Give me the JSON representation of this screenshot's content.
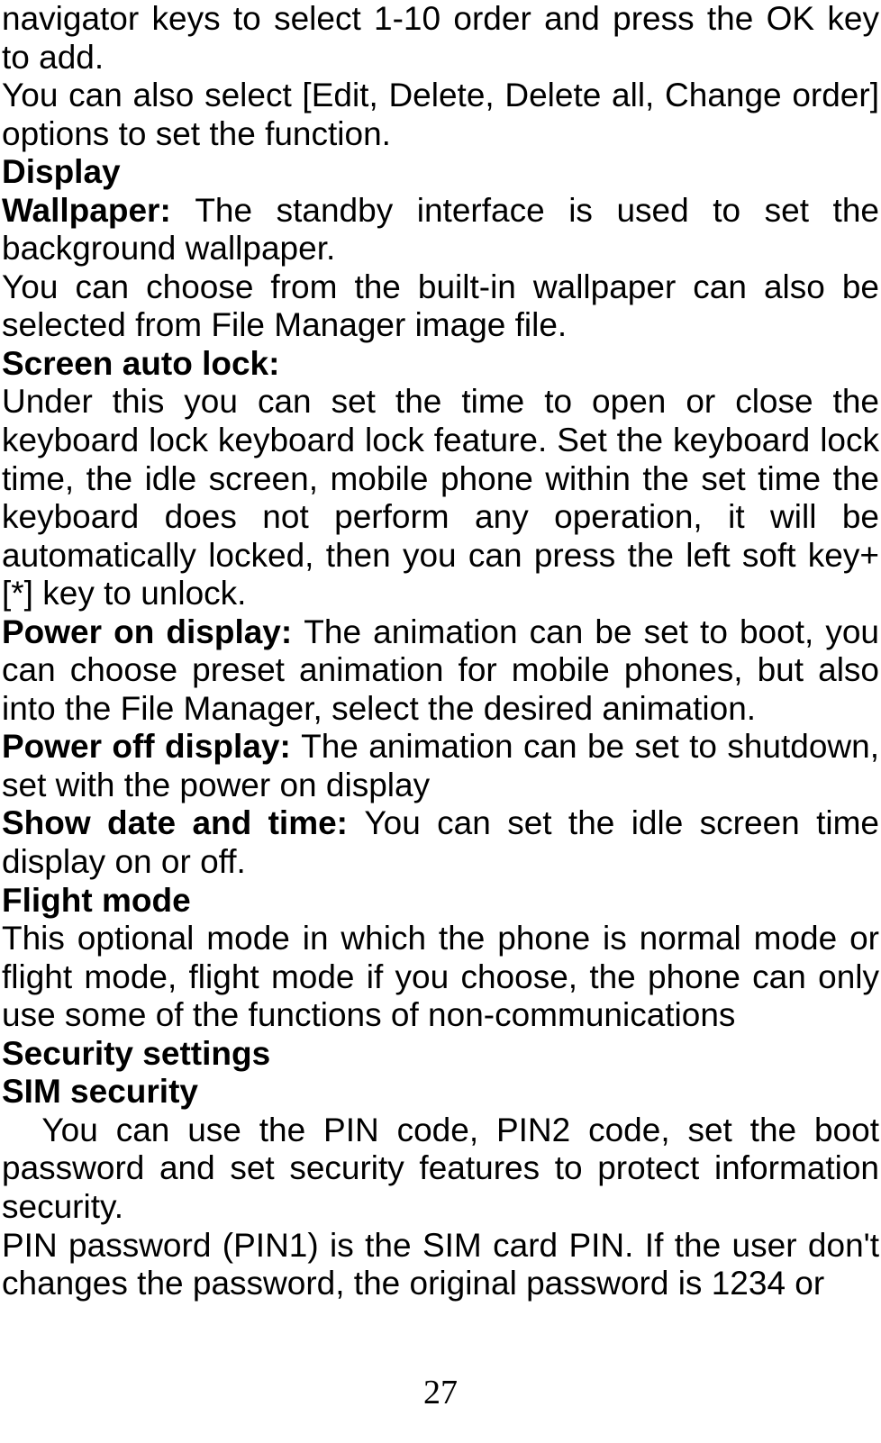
{
  "paragraphs": {
    "p1": "navigator keys to select 1-10 order and press the OK key to add.",
    "p2": "You can also select [Edit, Delete, Delete all, Change order] options to set the function.",
    "h_display": "Display",
    "wallpaper_label": "Wallpaper: ",
    "wallpaper_text": "The standby interface is used to set the background wallpaper.",
    "wallpaper_p2": "You can choose from the built-in wallpaper can also be selected from File Manager image file.",
    "screen_auto_lock_label": "Screen auto lock:",
    "screen_auto_lock_text": "Under this you can set the time to open or close the keyboard lock keyboard lock feature. Set the keyboard lock time, the idle screen, mobile phone within the set time the keyboard does not perform any operation, it will be automatically locked, then you can press the left soft key+ [*] key to unlock.",
    "power_on_label": "Power on display: ",
    "power_on_text": "The animation can be set to boot, you can choose preset animation for mobile phones, but also into the File Manager, select the desired animation.",
    "power_off_label": "Power off display: ",
    "power_off_text": "The animation can be set to shutdown, set with the power on display",
    "show_date_label": "Show date and time: ",
    "show_date_text": "You can set the idle screen time display on or off.",
    "h_flight": "Flight mode",
    "flight_text": "This optional mode in which the phone is normal mode or flight mode, flight mode if you choose, the phone can only use some of the functions of non-communications",
    "h_security": "Security settings",
    "h_sim": "SIM security",
    "sim_p1": "You can use the PIN code, PIN2 code, set the boot password and set security features to protect information security.",
    "sim_p2": "PIN password (PIN1) is the SIM card PIN. If the user don't changes the password, the original password is 1234 or"
  },
  "page_number": "27"
}
